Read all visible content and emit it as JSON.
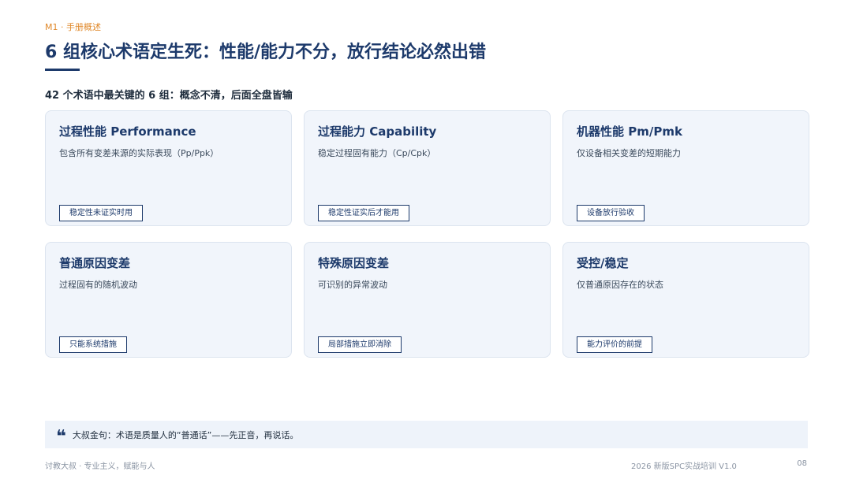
{
  "header": {
    "section_tag": "M1 · 手册概述",
    "title": "6 组核心术语定生死：性能/能力不分，放行结论必然出错",
    "subtitle": "42 个术语中最关键的 6 组：概念不清，后面全盘皆输"
  },
  "cards": [
    {
      "title": "过程性能 Performance",
      "desc": "包含所有变差来源的实际表现（Pp/Ppk）",
      "tag": "稳定性未证实时用"
    },
    {
      "title": "过程能力 Capability",
      "desc": "稳定过程固有能力（Cp/Cpk）",
      "tag": "稳定性证实后才能用"
    },
    {
      "title": "机器性能 Pm/Pmk",
      "desc": "仅设备相关变差的短期能力",
      "tag": "设备放行验收"
    },
    {
      "title": "普通原因变差",
      "desc": "过程固有的随机波动",
      "tag": "只能系统措施"
    },
    {
      "title": "特殊原因变差",
      "desc": "可识别的异常波动",
      "tag": "局部措施立即消除"
    },
    {
      "title": "受控/稳定",
      "desc": "仅普通原因存在的状态",
      "tag": "能力评价的前提"
    }
  ],
  "quote": {
    "icon": "quote-mark-icon",
    "symbol": "❝",
    "text": "大叔金句：术语是质量人的“普通话”——先正音，再说话。"
  },
  "footer": {
    "left": "讨教大叔 · 专业主义，赋能与人",
    "right": "2026 新版SPC实战培训 V1.0",
    "page": "08"
  },
  "colors": {
    "primary": "#1d3a6b",
    "accent": "#e0892b",
    "card_bg": "#f1f5fb"
  }
}
